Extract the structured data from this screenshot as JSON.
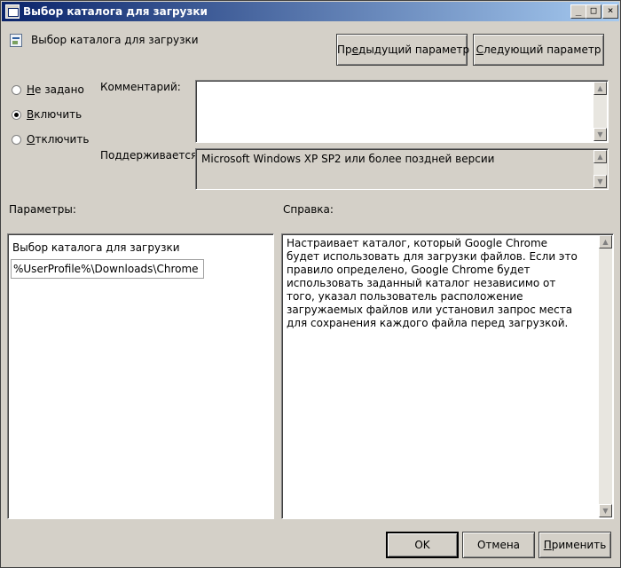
{
  "window": {
    "title": "Выбор каталога для загрузки",
    "controls": {
      "minimize": "_",
      "maximize": "□",
      "close": "×"
    }
  },
  "header": {
    "icon": "policy-icon",
    "title": "Выбор каталога для загрузки",
    "prev_button_pre": "Пр",
    "prev_button_ul": "е",
    "prev_button_post": "дыдущий параметр",
    "next_button_pre": "",
    "next_button_ul": "С",
    "next_button_post": "ледующий параметр"
  },
  "state": {
    "options": [
      {
        "ul": "Н",
        "rest": "е задано",
        "checked": false
      },
      {
        "ul": "В",
        "rest": "ключить",
        "checked": true
      },
      {
        "ul": "О",
        "rest": "тключить",
        "checked": false
      }
    ]
  },
  "comment": {
    "label": "Комментарий:",
    "value": ""
  },
  "supported": {
    "label": "Поддерживается:",
    "value": "Microsoft Windows XP SP2 или более поздней версии"
  },
  "params": {
    "header": "Параметры:",
    "field_label": "Выбор каталога для загрузки",
    "field_value": "%UserProfile%\\Downloads\\Chrome"
  },
  "help": {
    "header": "Справка:",
    "text": "Настраивает каталог, который Google Chrome будет использовать для загрузки файлов. Если это правило определено, Google Chrome будет использовать заданный каталог независимо от того, указал пользователь расположение загружаемых файлов или установил запрос места для сохранения каждого файла перед загрузкой."
  },
  "footer": {
    "ok": "OK",
    "cancel": "Отмена",
    "apply_ul": "П",
    "apply_rest": "рименить"
  },
  "scroll_arrows": {
    "up": "▲",
    "down": "▼"
  }
}
